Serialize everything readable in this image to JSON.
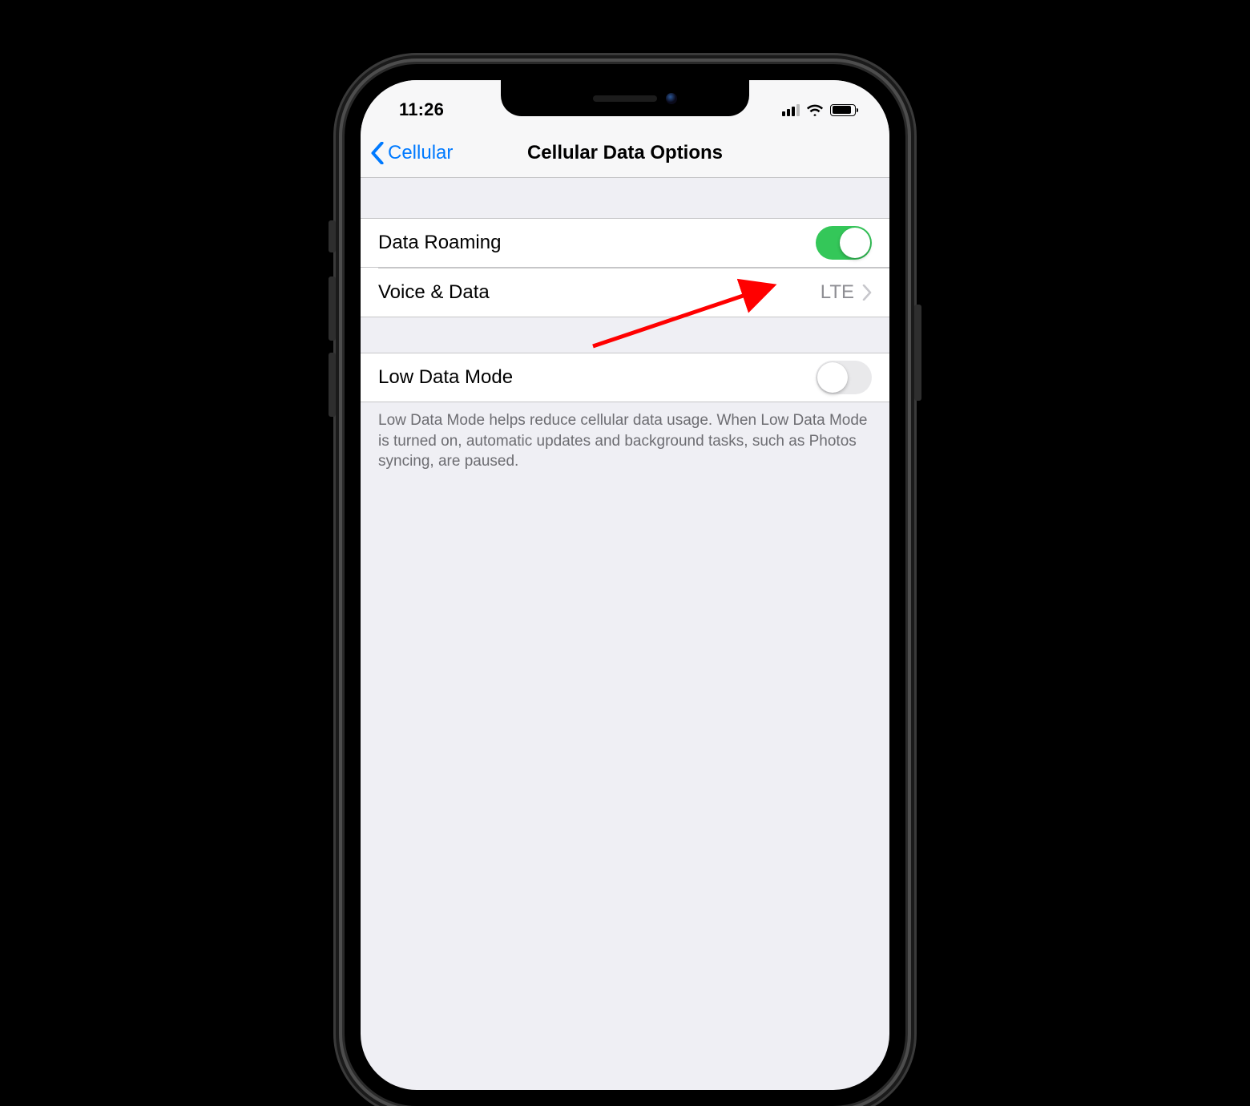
{
  "status_bar": {
    "time": "11:26"
  },
  "nav": {
    "back_label": "Cellular",
    "title": "Cellular Data Options"
  },
  "rows": {
    "data_roaming": {
      "label": "Data Roaming",
      "on": true
    },
    "voice_data": {
      "label": "Voice & Data",
      "value": "LTE"
    },
    "low_data": {
      "label": "Low Data Mode",
      "on": false
    }
  },
  "footer": "Low Data Mode helps reduce cellular data usage. When Low Data Mode is turned on, automatic updates and background tasks, such as Photos syncing, are paused."
}
